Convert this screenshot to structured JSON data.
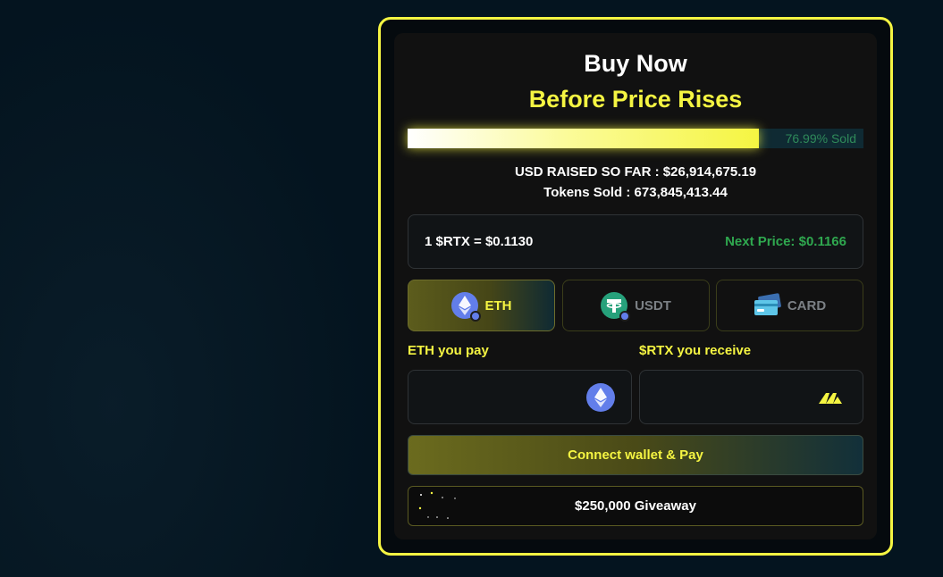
{
  "header": {
    "title": "Buy Now",
    "subtitle": "Before Price Rises"
  },
  "progress": {
    "percent_sold": 76.99,
    "label": "76.99% Sold"
  },
  "stats": {
    "usd_raised": "USD RAISED SO FAR : $26,914,675.19",
    "tokens_sold": "Tokens Sold : 673,845,413.44"
  },
  "price": {
    "current": "1 $RTX =  $0.1130",
    "next": "Next Price: $0.1166"
  },
  "payment_tabs": [
    {
      "label": "ETH",
      "icon": "ethereum-icon",
      "active": true
    },
    {
      "label": "USDT",
      "icon": "tether-icon",
      "active": false
    },
    {
      "label": "CARD",
      "icon": "credit-card-icon",
      "active": false
    }
  ],
  "form": {
    "pay_label": "ETH you pay",
    "pay_value": "",
    "receive_label": "$RTX you receive",
    "receive_value": ""
  },
  "actions": {
    "connect_label": "Connect wallet & Pay",
    "giveaway_label": "$250,000 Giveaway"
  },
  "colors": {
    "accent": "#f5f542",
    "background": "#04141f",
    "card": "#111111",
    "next_price": "#2fa84f"
  }
}
